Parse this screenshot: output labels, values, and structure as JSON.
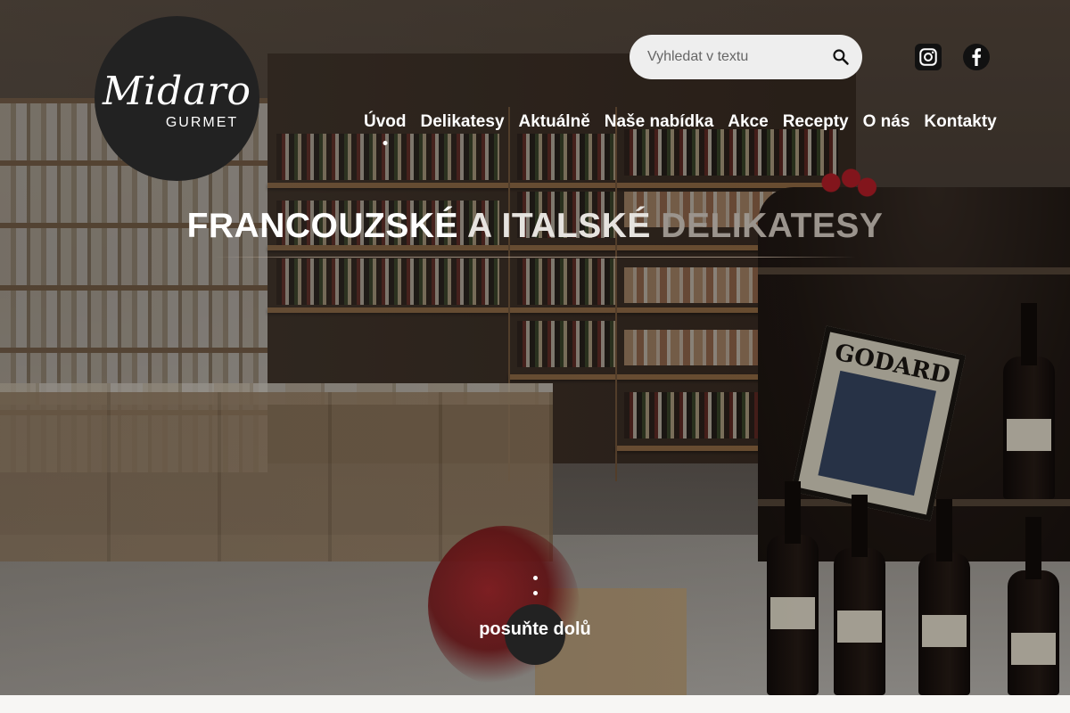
{
  "brand": {
    "logo_script": "Midaro",
    "logo_sub": "GURMET"
  },
  "search": {
    "placeholder": "Vyhledat v textu",
    "icon": "search-icon"
  },
  "social": {
    "instagram_icon": "instagram-icon",
    "facebook_icon": "facebook-icon"
  },
  "nav": {
    "items": [
      {
        "label": "Úvod",
        "active": true
      },
      {
        "label": "Delikatesy"
      },
      {
        "label": "Aktuálně"
      },
      {
        "label": "Naše nabídka"
      },
      {
        "label": "Akce"
      },
      {
        "label": "Recepty"
      },
      {
        "label": "O nás"
      },
      {
        "label": "Kontakty"
      }
    ]
  },
  "hero": {
    "headline_part1": "FRANCOUZSKÉ",
    "headline_part2": "A ITALSKÉ",
    "headline_part3": "DELIKATESY",
    "scroll_label": "posuňte dolů",
    "sign_text": "GODARD"
  },
  "colors": {
    "logo_bg": "#222222",
    "search_bg": "#eeeeee",
    "nav_text": "#ffffff"
  }
}
